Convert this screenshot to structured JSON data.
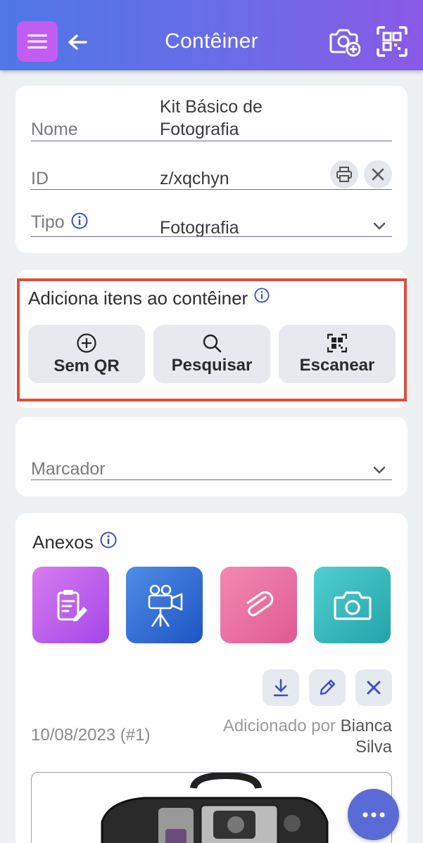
{
  "header": {
    "title": "Contêiner",
    "menu_icon": "hamburger-icon",
    "back_icon": "arrow-left-icon",
    "camera_add_icon": "camera-add-icon",
    "qr_scan_icon": "qr-scan-icon",
    "gradient": [
      "#4f77e6",
      "#8a5ae6"
    ],
    "menu_color": "#c25cf2"
  },
  "details": {
    "name_label": "Nome",
    "name_value_line1": "Kit Básico de",
    "name_value_line2": "Fotografia",
    "id_label": "ID",
    "id_value": "z/xqchyn",
    "type_label": "Tipo",
    "type_value": "Fotografia"
  },
  "add_items": {
    "title": "Adiciona itens ao contêiner",
    "buttons": [
      {
        "label": "Sem QR",
        "icon": "plus-circle-icon"
      },
      {
        "label": "Pesquisar",
        "icon": "search-icon"
      },
      {
        "label": "Escanear",
        "icon": "qr-scan-icon"
      }
    ]
  },
  "marker": {
    "label": "Marcador"
  },
  "attachments": {
    "title": "Anexos",
    "tiles": [
      {
        "name": "note-icon",
        "color_from": "#d77cf0",
        "color_to": "#a347e8"
      },
      {
        "name": "video-camera-icon",
        "color_from": "#4f8de6",
        "color_to": "#1e55c2"
      },
      {
        "name": "paperclip-icon",
        "color_from": "#f28ab0",
        "color_to": "#e05a93"
      },
      {
        "name": "camera-icon",
        "color_from": "#4fcfcf",
        "color_to": "#24a3aa"
      }
    ],
    "entry": {
      "date": "10/08/2023 (#1)",
      "added_by_prefix": "Adicionado por",
      "added_by_first": "Bianca",
      "added_by_last": "Silva"
    }
  },
  "colors": {
    "accent": "#5b6bd6",
    "highlight": "#e04b3b"
  }
}
